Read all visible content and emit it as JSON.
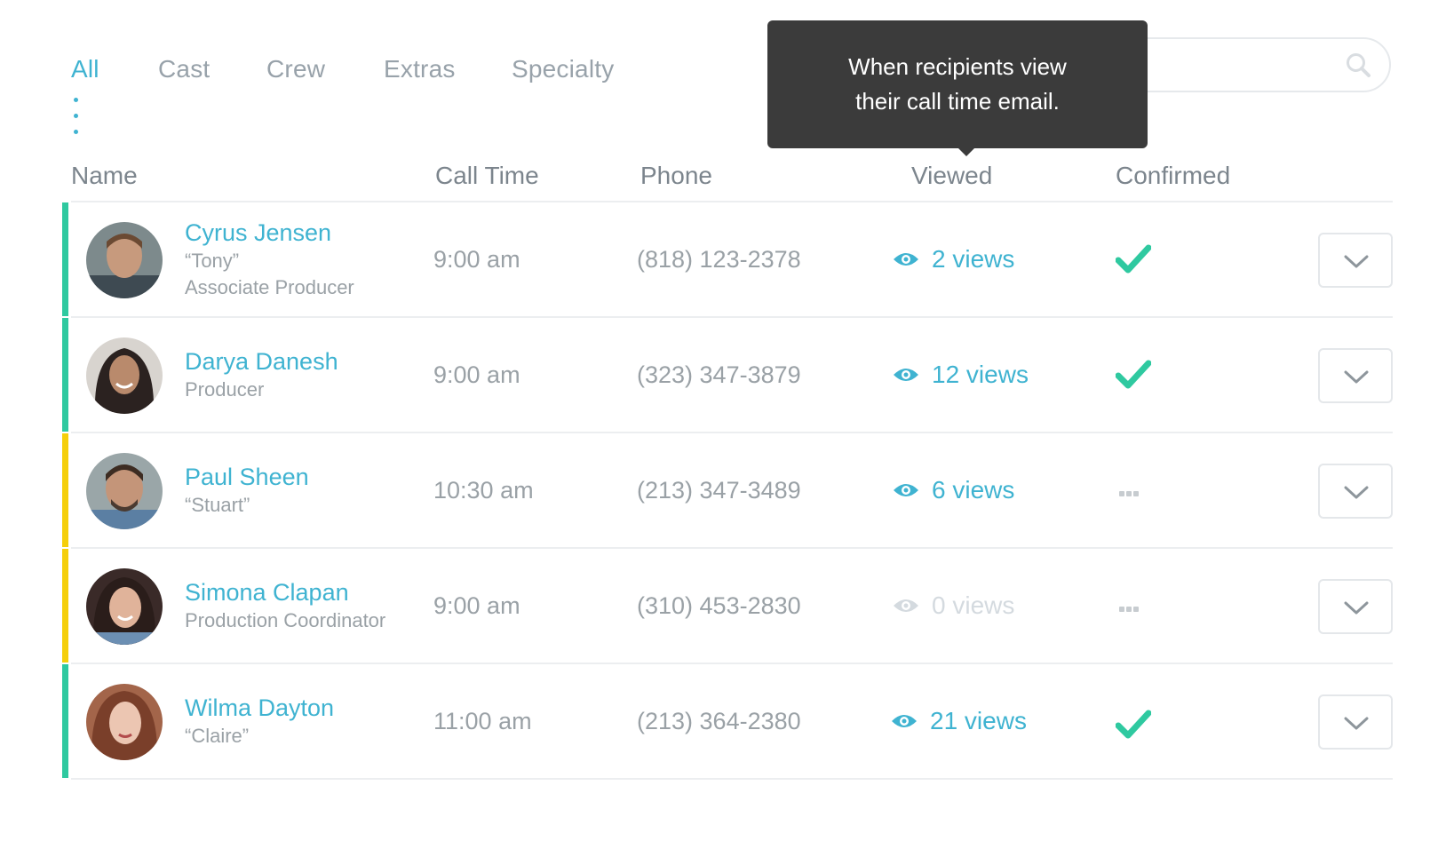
{
  "tabs": [
    {
      "label": "All",
      "active": true
    },
    {
      "label": "Cast",
      "active": false
    },
    {
      "label": "Crew",
      "active": false
    },
    {
      "label": "Extras",
      "active": false
    },
    {
      "label": "Specialty",
      "active": false
    }
  ],
  "search": {
    "value": "",
    "placeholder": "",
    "icon": "search-icon"
  },
  "tooltip": {
    "text": "When recipients view their call time email."
  },
  "table": {
    "columns": [
      "Name",
      "Call Time",
      "Phone",
      "Viewed",
      "Confirmed"
    ],
    "rows": [
      {
        "name": "Cyrus Jensen",
        "nickname": "“Tony”",
        "role": "Associate Producer",
        "call_time": "9:00 am",
        "phone": "(818) 123-2378",
        "views": "2 views",
        "confirmed": true,
        "status_color": "#2fc9a0"
      },
      {
        "name": "Darya Danesh",
        "nickname": "",
        "role": "Producer",
        "call_time": "9:00 am",
        "phone": "(323) 347-3879",
        "views": "12 views",
        "confirmed": true,
        "status_color": "#2fc9a0"
      },
      {
        "name": "Paul Sheen",
        "nickname": "“Stuart”",
        "role": "",
        "call_time": "10:30 am",
        "phone": "(213) 347-3489",
        "views": "6 views",
        "confirmed": false,
        "status_color": "#f5cf0a"
      },
      {
        "name": "Simona Clapan",
        "nickname": "",
        "role": "Production Coordinator",
        "call_time": "9:00 am",
        "phone": "(310) 453-2830",
        "views": "0 views",
        "confirmed": false,
        "status_color": "#f5cf0a"
      },
      {
        "name": "Wilma Dayton",
        "nickname": "“Claire”",
        "role": "",
        "call_time": "11:00 am",
        "phone": "(213) 364-2380",
        "views": "21 views",
        "confirmed": true,
        "status_color": "#2fc9a0"
      }
    ]
  },
  "colors": {
    "accent": "#3fb3d1",
    "confirmed": "#2fc9a0",
    "pending": "#f5cf0a",
    "tooltip_bg": "#3b3b3b"
  }
}
